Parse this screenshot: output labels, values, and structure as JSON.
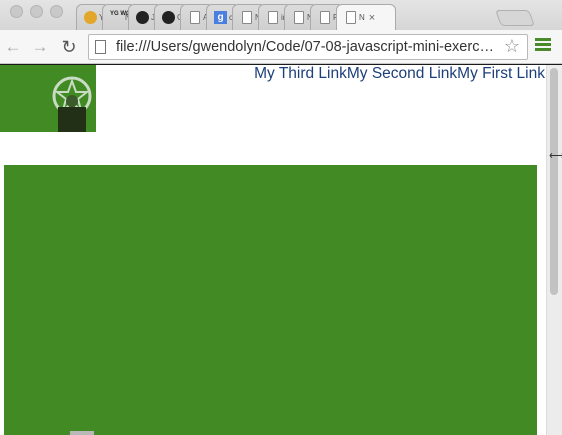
{
  "browser": {
    "tabs": [
      {
        "icon": "paw-icon",
        "label": "Y"
      },
      {
        "icon": "yg-icon",
        "label": "N"
      },
      {
        "icon": "github-icon",
        "label": "J"
      },
      {
        "icon": "github-icon",
        "label": "G"
      },
      {
        "icon": "page-icon",
        "label": "A"
      },
      {
        "icon": "google-icon",
        "label": "c"
      },
      {
        "icon": "page-icon",
        "label": "N"
      },
      {
        "icon": "page-icon",
        "label": "ir"
      },
      {
        "icon": "page-icon",
        "label": "N"
      },
      {
        "icon": "page-icon",
        "label": "R"
      },
      {
        "icon": "page-icon",
        "label": "N",
        "active": true
      }
    ],
    "tab_close": "×",
    "url": "file:///Users/gwendolyn/Code/07-08-javascript-mini-exerc…",
    "favicon_text": {
      "yg": "YG WG",
      "google": "g"
    }
  },
  "page": {
    "nav_links": [
      "My Third Link",
      "My Second Link",
      "My First Link"
    ],
    "colors": {
      "accent": "#418a24",
      "link": "#1d3f7a"
    }
  }
}
